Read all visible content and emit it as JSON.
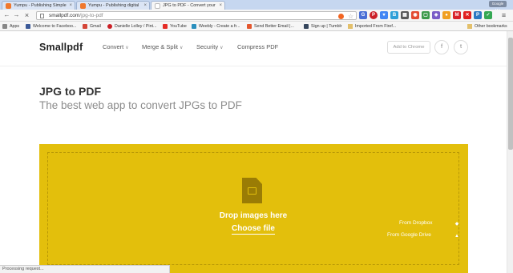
{
  "browser": {
    "tabs": [
      {
        "label": "Yumpu - Publishing Simple",
        "favicon_color": "#f0782d"
      },
      {
        "label": "Yumpu - Publishing digital",
        "favicon_color": "#f0782d"
      },
      {
        "label": "JPG to PDF - Convert your",
        "favicon_color": "#cccccc"
      }
    ],
    "profile_label": "Google MA",
    "url_domain": "smallpdf.com",
    "url_path": "/jpg-to-pdf",
    "bookmarks": [
      {
        "label": "Apps",
        "color": "#888888"
      },
      {
        "label": "Welcome to Faceboo...",
        "color": "#3b5998"
      },
      {
        "label": "Gmail",
        "color": "#d44638"
      },
      {
        "label": "Danielle Lolley / Pint...",
        "color": "#cb2027"
      },
      {
        "label": "YouTube",
        "color": "#e52d27"
      },
      {
        "label": "Weebly - Create a fr...",
        "color": "#2a8fbd"
      },
      {
        "label": "Send Better Email |...",
        "color": "#e4572e"
      },
      {
        "label": "Sign up | Tumblr",
        "color": "#36465d"
      },
      {
        "label": "Imported From Firef...",
        "color": "#e3c06b"
      },
      {
        "label": "Other bookmarks",
        "color": "#e3c06b"
      }
    ]
  },
  "site": {
    "logo": "Smallpdf",
    "nav": [
      "Convert",
      "Merge & Split",
      "Security",
      "Compress PDF"
    ],
    "chrome_button": "Add to Chrome",
    "social": [
      "f",
      "t"
    ]
  },
  "main": {
    "title": "JPG to PDF",
    "subtitle": "The best web app to convert JPGs to PDF",
    "drop_label": "Drop images here",
    "choose_label": "Choose file",
    "dropbox_label": "From Dropbox",
    "gdrive_label": "From Google Drive",
    "accent_color": "#e3bf0c"
  },
  "status_text": "Processing request..."
}
